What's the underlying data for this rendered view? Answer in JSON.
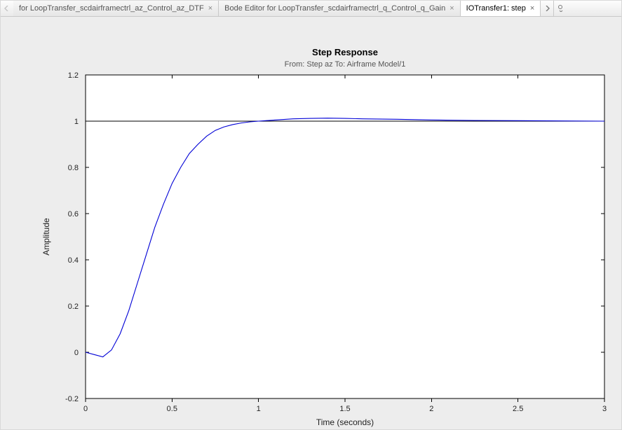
{
  "tabs": {
    "items": [
      {
        "label": "for LoopTransfer_scdairframectrl_az_Control_az_DTF",
        "active": false
      },
      {
        "label": "Bode Editor for LoopTransfer_scdairframectrl_q_Control_q_Gain",
        "active": false
      },
      {
        "label": "IOTransfer1: step",
        "active": true
      }
    ]
  },
  "chart_data": {
    "type": "line",
    "title": "Step Response",
    "subtitle": "From: Step az  To: Airframe Model/1",
    "xlabel": "Time (seconds)",
    "ylabel": "Amplitude",
    "xlim": [
      0,
      3
    ],
    "ylim": [
      -0.2,
      1.2
    ],
    "xticks": [
      0,
      0.5,
      1,
      1.5,
      2,
      2.5,
      3
    ],
    "yticks": [
      -0.2,
      0,
      0.2,
      0.4,
      0.6,
      0.8,
      1,
      1.2
    ],
    "reference_y": 1.0,
    "series": [
      {
        "name": "step",
        "x": [
          0,
          0.05,
          0.1,
          0.15,
          0.2,
          0.25,
          0.3,
          0.35,
          0.4,
          0.45,
          0.5,
          0.55,
          0.6,
          0.65,
          0.7,
          0.75,
          0.8,
          0.85,
          0.9,
          0.95,
          1.0,
          1.1,
          1.2,
          1.3,
          1.4,
          1.5,
          1.6,
          1.8,
          2.0,
          2.25,
          2.5,
          2.75,
          3.0
        ],
        "y": [
          0.0,
          -0.01,
          -0.02,
          0.01,
          0.08,
          0.18,
          0.3,
          0.42,
          0.54,
          0.64,
          0.73,
          0.8,
          0.86,
          0.9,
          0.935,
          0.96,
          0.975,
          0.985,
          0.992,
          0.997,
          1.0,
          1.005,
          1.01,
          1.012,
          1.013,
          1.012,
          1.01,
          1.008,
          1.005,
          1.003,
          1.002,
          1.001,
          1.0
        ]
      }
    ]
  }
}
